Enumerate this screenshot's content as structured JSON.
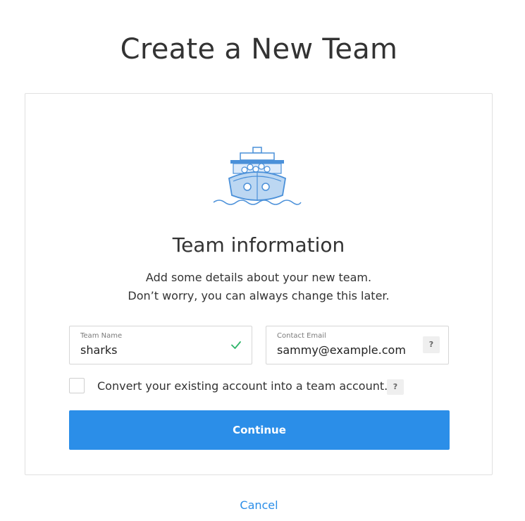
{
  "page": {
    "title": "Create a New Team"
  },
  "card": {
    "illustration_icon": "ship-icon",
    "section_title": "Team information",
    "description_line_1": "Add some details about your new team.",
    "description_line_2": "Don’t worry, you can always change this later.",
    "team_name_field": {
      "label": "Team Name",
      "value": "sharks",
      "status_icon": "checkmark-icon"
    },
    "contact_email_field": {
      "label": "Contact Email",
      "value": "sammy@example.com",
      "help_label": "?"
    },
    "convert_checkbox": {
      "label": "Convert your existing account into a team account.",
      "checked": false,
      "help_label": "?"
    },
    "continue_label": "Continue"
  },
  "cancel_label": "Cancel",
  "colors": {
    "accent": "#2b8ee8",
    "success": "#2fb56a",
    "illustration_blue": "#4a90d9",
    "illustration_light": "#bcd7f2"
  }
}
